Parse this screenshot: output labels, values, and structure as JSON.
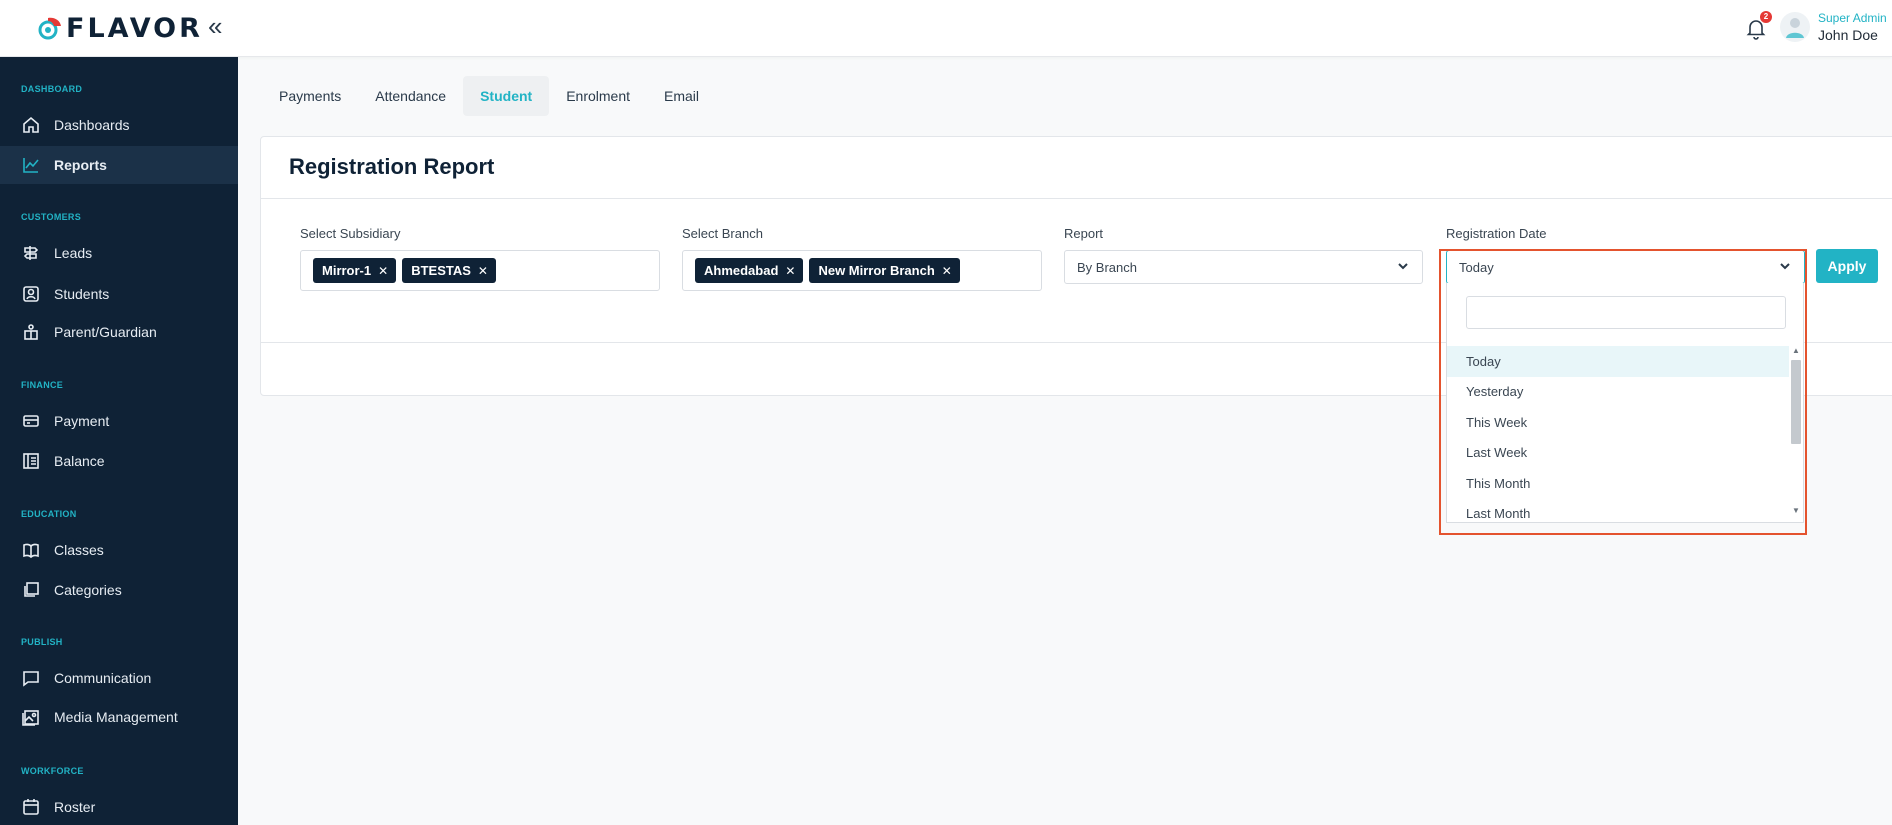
{
  "app": {
    "logo_text": "FLAVOR"
  },
  "header": {
    "notification_count": "2",
    "user_role": "Super Admin",
    "user_name": "John Doe"
  },
  "sidebar": {
    "sections": [
      {
        "title": "DASHBOARD",
        "items": [
          {
            "label": "Dashboards",
            "icon": "home-icon"
          },
          {
            "label": "Reports",
            "icon": "chart-line-icon",
            "active": true
          }
        ]
      },
      {
        "title": "CUSTOMERS",
        "items": [
          {
            "label": "Leads",
            "icon": "signpost-icon"
          },
          {
            "label": "Students",
            "icon": "user-square-icon"
          },
          {
            "label": "Parent/Guardian",
            "icon": "family-icon"
          }
        ]
      },
      {
        "title": "FINANCE",
        "items": [
          {
            "label": "Payment",
            "icon": "card-icon"
          },
          {
            "label": "Balance",
            "icon": "ledger-icon"
          }
        ]
      },
      {
        "title": "EDUCATION",
        "items": [
          {
            "label": "Classes",
            "icon": "book-icon"
          },
          {
            "label": "Categories",
            "icon": "layers-icon"
          }
        ]
      },
      {
        "title": "PUBLISH",
        "items": [
          {
            "label": "Communication",
            "icon": "message-icon"
          },
          {
            "label": "Media Management",
            "icon": "image-icon"
          }
        ]
      },
      {
        "title": "WORKFORCE",
        "items": [
          {
            "label": "Roster",
            "icon": "calendar-icon"
          }
        ]
      }
    ]
  },
  "tabs": [
    {
      "label": "Payments"
    },
    {
      "label": "Attendance"
    },
    {
      "label": "Student",
      "active": true
    },
    {
      "label": "Enrolment"
    },
    {
      "label": "Email"
    }
  ],
  "report": {
    "title": "Registration Report",
    "subsidiary": {
      "label": "Select Subsidiary",
      "chips": [
        "Mirror-1",
        "BTESTAS"
      ]
    },
    "branch": {
      "label": "Select Branch",
      "chips": [
        "Ahmedabad",
        "New Mirror Branch"
      ]
    },
    "report_type": {
      "label": "Report",
      "value": "By Branch"
    },
    "registration_date": {
      "label": "Registration Date",
      "value": "Today",
      "search_placeholder": "",
      "options": [
        "Today",
        "Yesterday",
        "This Week",
        "Last Week",
        "This Month",
        "Last Month"
      ],
      "selected": "Today"
    },
    "apply_label": "Apply"
  },
  "colors": {
    "accent": "#22b3c5",
    "sidebar_bg": "#0f2236",
    "highlight": "#e4532e",
    "badge": "#e53935"
  }
}
